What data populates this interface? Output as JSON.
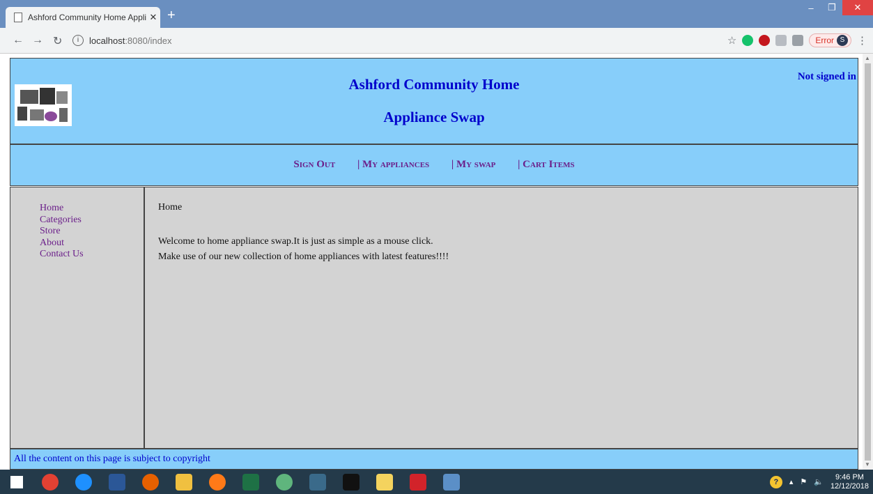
{
  "browser": {
    "tab_title": "Ashford Community Home Appli",
    "new_tab": "+",
    "tab_close": "✕",
    "url_host": "localhost",
    "url_path": ":8080/index",
    "error_label": "Error",
    "profile_initial": "S",
    "window_controls": {
      "minimize": "–",
      "maximize": "❐",
      "close": "✕"
    }
  },
  "header": {
    "title_line1": "Ashford Community Home",
    "title_line2": "Appliance Swap",
    "signin_status": "Not signed in"
  },
  "menu": {
    "items": [
      "Sign Out",
      "| My appliances",
      "| My swap",
      "| Cart Items"
    ]
  },
  "sidebar": {
    "items": [
      "Home",
      "Categories",
      "Store",
      "About",
      "Contact Us"
    ]
  },
  "content": {
    "breadcrumb": "Home",
    "paragraph1": "Welcome to home appliance swap.It is just as simple as a mouse click.",
    "paragraph2": "Make use of our new collection of home appliances with latest features!!!!"
  },
  "footer": {
    "text": "All the content on this page is subject to copyright"
  },
  "taskbar": {
    "time": "9:46 PM",
    "date": "12/12/2018",
    "apps": [
      "start-icon",
      "chrome-icon",
      "internet-explorer-icon",
      "word-icon",
      "firefox-icon",
      "file-explorer-icon",
      "firefox-alt-icon",
      "excel-icon",
      "atom-icon",
      "mysql-workbench-icon",
      "command-prompt-icon",
      "folder-icon",
      "acrobat-icon",
      "virtualbox-icon"
    ]
  },
  "colors": {
    "header_bg": "#87cefa",
    "panel_bg": "#d3d3d3",
    "title_blue": "#0000cc",
    "link_purple": "#6b1f8a"
  }
}
